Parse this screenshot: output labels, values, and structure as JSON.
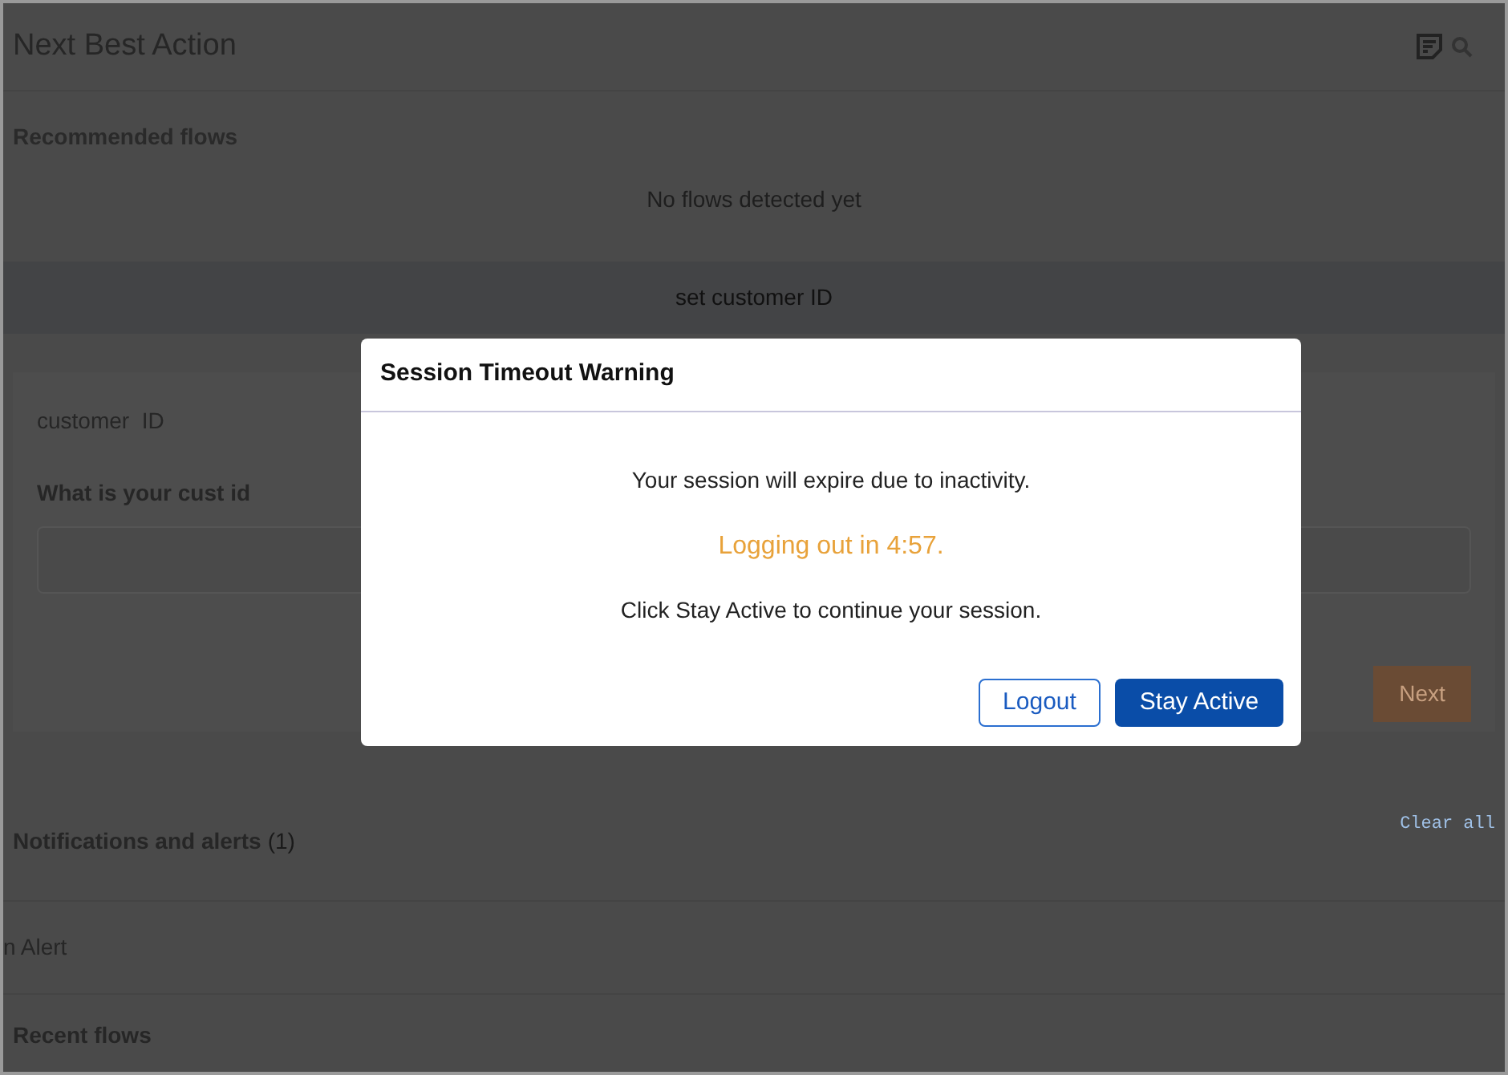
{
  "header": {
    "title": "Next Best Action"
  },
  "recommended": {
    "title": "Recommended flows",
    "empty": "No flows detected yet"
  },
  "flow_step": {
    "title": "set customer ID",
    "section": "customer  ID",
    "question": "What is your cust id",
    "button": "Next"
  },
  "notifications": {
    "title": "Notifications and alerts",
    "count": "(1)",
    "clear": "Clear all",
    "items": [
      "n Alert"
    ]
  },
  "recent": {
    "title": "Recent flows"
  },
  "dialog": {
    "title": "Session Timeout Warning",
    "message": "Your session will expire due to inactivity.",
    "countdown": "Logging out in 4:57.",
    "hint": "Click Stay Active to continue your session.",
    "buttons": [
      {
        "label": "Logout",
        "kind": "secondary"
      },
      {
        "label": "Stay Active",
        "kind": "primary"
      }
    ]
  }
}
